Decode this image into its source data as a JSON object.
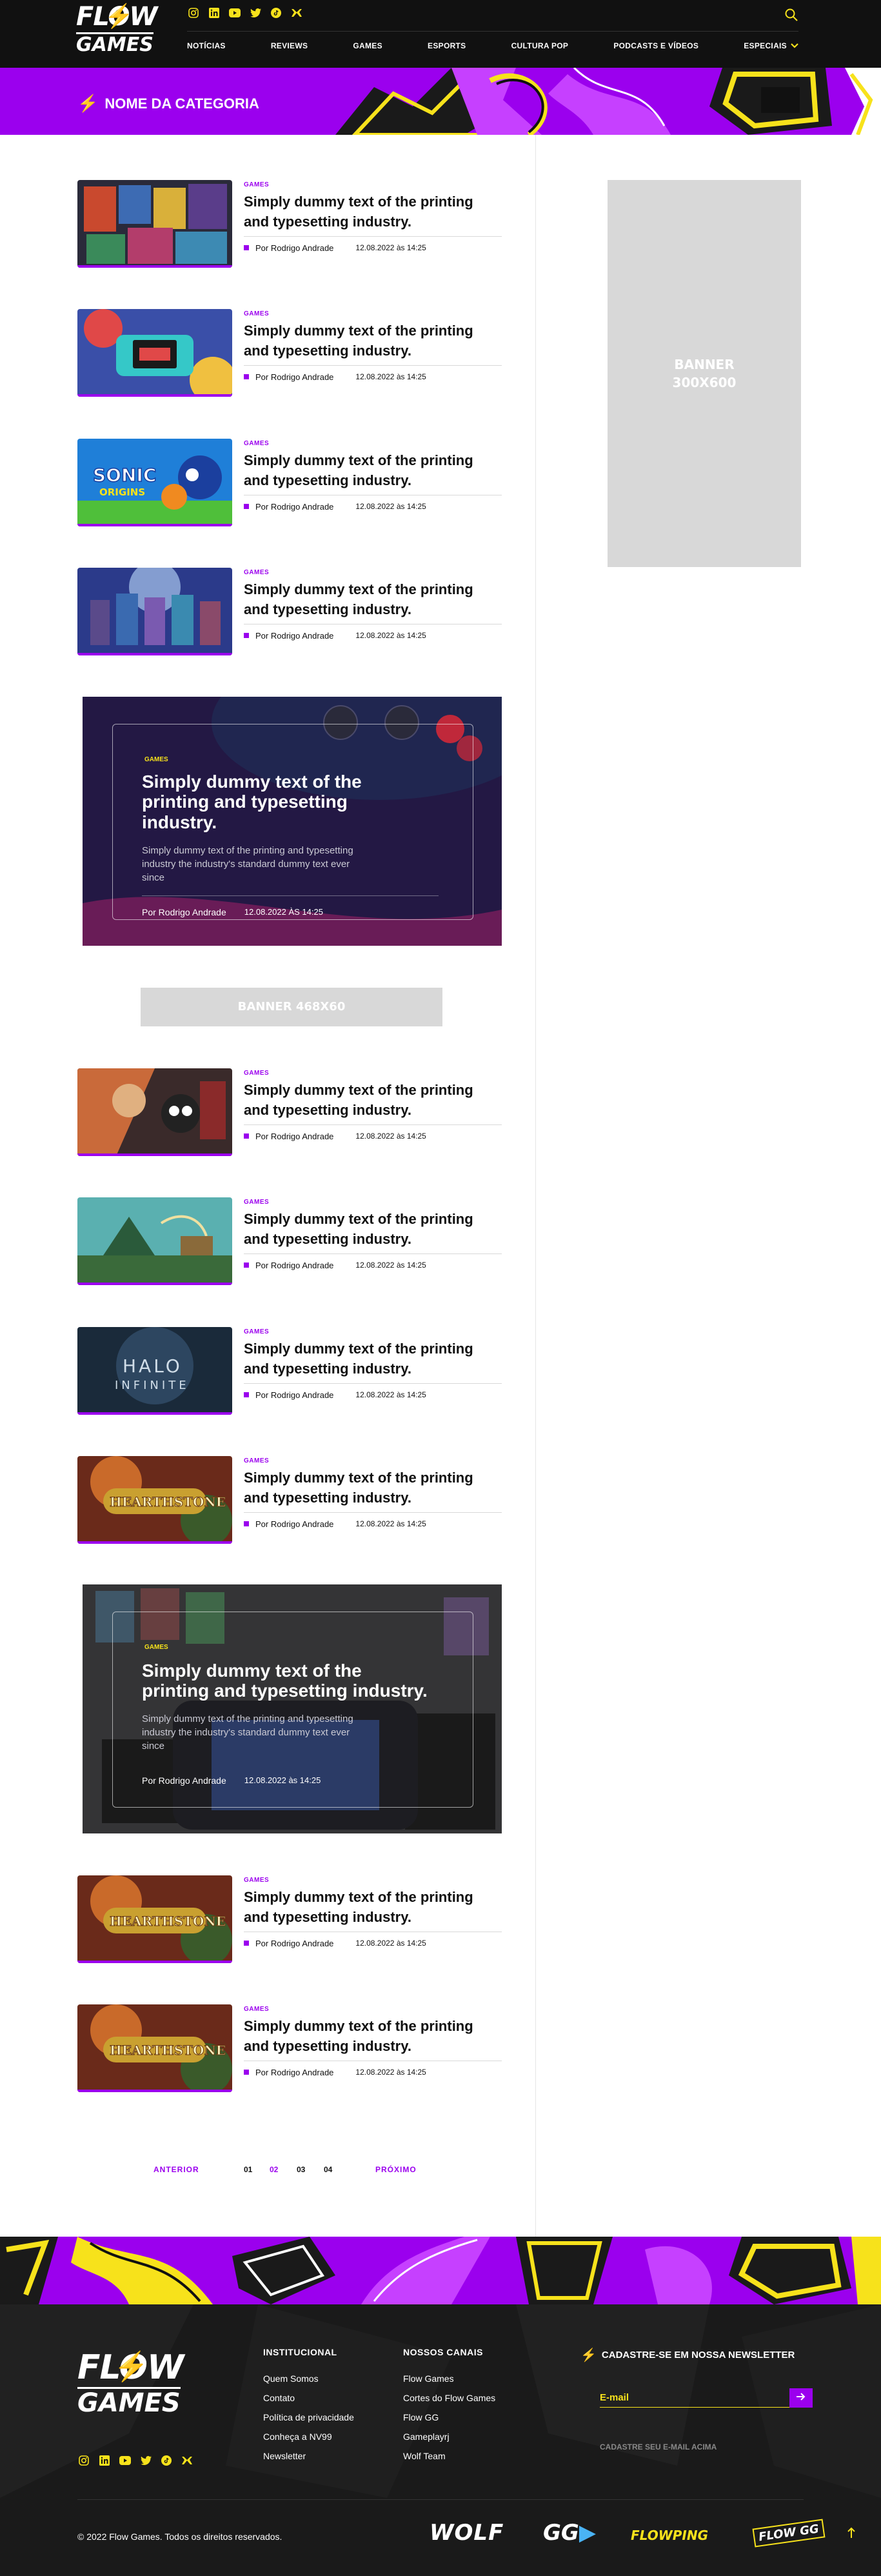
{
  "header": {
    "logo": {
      "line1": "FLOW",
      "line2": "GAMES"
    },
    "social": [
      "instagram-icon",
      "linkedin-icon",
      "youtube-icon",
      "twitter-icon",
      "tiktok-icon",
      "twitch-icon"
    ],
    "nav": [
      "NOTÍCIAS",
      "REVIEWS",
      "GAMES",
      "ESPORTS",
      "CULTURA POP",
      "PODCASTS E VÍDEOS",
      "ESPECIAIS"
    ]
  },
  "category": {
    "title": "NOME DA CATEGORIA"
  },
  "ad_300": "BANNER\n300X600",
  "ad_468": "BANNER 468X60",
  "articles": [
    {
      "category": "GAMES",
      "title": "Simply dummy text of the printing and typesetting industry.",
      "author": "Por Rodrigo Andrade",
      "date": "12.08.2022 às 14:25",
      "thumb_theme": "collage"
    },
    {
      "category": "GAMES",
      "title": "Simply dummy text of the printing and typesetting industry.",
      "author": "Por Rodrigo Andrade",
      "date": "12.08.2022 às 14:25",
      "thumb_theme": "switch"
    },
    {
      "category": "GAMES",
      "title": "Simply dummy text of the printing and typesetting industry.",
      "author": "Por Rodrigo Andrade",
      "date": "12.08.2022 às 14:25",
      "thumb_theme": "sonic"
    },
    {
      "category": "GAMES",
      "title": "Simply dummy text of the printing and typesetting industry.",
      "author": "Por Rodrigo Andrade",
      "date": "12.08.2022 às 14:25",
      "thumb_theme": "xbox"
    },
    {
      "category": "GAMES",
      "title": "Simply dummy text of the printing and typesetting industry.",
      "author": "Por Rodrigo Andrade",
      "date": "12.08.2022 às 14:25",
      "thumb_theme": "warzone"
    },
    {
      "category": "GAMES",
      "title": "Simply dummy text of the printing and typesetting industry.",
      "author": "Por Rodrigo Andrade",
      "date": "12.08.2022 às 14:25",
      "thumb_theme": "island"
    },
    {
      "category": "GAMES",
      "title": "Simply dummy text of the printing and typesetting industry.",
      "author": "Por Rodrigo Andrade",
      "date": "12.08.2022 às 14:25",
      "thumb_theme": "halo"
    },
    {
      "category": "GAMES",
      "title": "Simply dummy text of the printing and typesetting industry.",
      "author": "Por Rodrigo Andrade",
      "date": "12.08.2022 às 14:25",
      "thumb_theme": "hearthstone"
    },
    {
      "category": "GAMES",
      "title": "Simply dummy text of the printing and typesetting industry.",
      "author": "Por Rodrigo Andrade",
      "date": "12.08.2022 às 14:25",
      "thumb_theme": "hearthstone"
    },
    {
      "category": "GAMES",
      "title": "Simply dummy text of the printing and typesetting industry.",
      "author": "Por Rodrigo Andrade",
      "date": "12.08.2022 às 14:25",
      "thumb_theme": "hearthstone"
    }
  ],
  "thumb_text": {
    "sonic": "SONIC",
    "sonic_sub": "ORIGINS",
    "halo": "HALO",
    "halo_sub": "INFINITE",
    "hearthstone": "HEARTHSTONE"
  },
  "featured": [
    {
      "category": "GAMES",
      "title": "Simply dummy text of the printing and typesetting industry.",
      "description": "Simply dummy text of the printing and typesetting industry  the industry's standard dummy text ever since",
      "author": "Por Rodrigo Andrade",
      "date": "12.08.2022 ÀS 14:25",
      "theme": "controller"
    },
    {
      "category": "GAMES",
      "title": "Simply dummy text of the printing and typesetting industry.",
      "description": "Simply dummy text of the printing and typesetting industry  the industry's standard dummy text ever since",
      "author": "Por Rodrigo Andrade",
      "date": "12.08.2022 às 14:25",
      "theme": "handheld"
    }
  ],
  "pagination": {
    "prev": "ANTERIOR",
    "pages": [
      "01",
      "02",
      "03",
      "04"
    ],
    "active": "02",
    "next": "PRÓXIMO"
  },
  "footer": {
    "institucional": {
      "title": "INSTITUCIONAL",
      "links": [
        "Quem Somos",
        "Contato",
        "Política de privacidade",
        "Conheça a NV99",
        "Newsletter"
      ]
    },
    "canais": {
      "title": "NOSSOS CANAIS",
      "links": [
        "Flow Games",
        "Cortes do Flow Games",
        "Flow GG",
        "Gameplayrj",
        "Wolf Team"
      ]
    },
    "newsletter": {
      "title": "CADASTRE-SE EM NOSSA NEWSLETTER",
      "placeholder": "E-mail",
      "hint": "CADASTRE SEU E-MAIL ACIMA"
    },
    "copyright": "© 2022 Flow Games. Todos os direitos reservados.",
    "brands": [
      "WOLF",
      "GG",
      "FLOWPING",
      "FLOW GG"
    ]
  },
  "colors": {
    "accent": "#9b00ee",
    "yellow": "#f7e21b",
    "dark": "#111111"
  }
}
